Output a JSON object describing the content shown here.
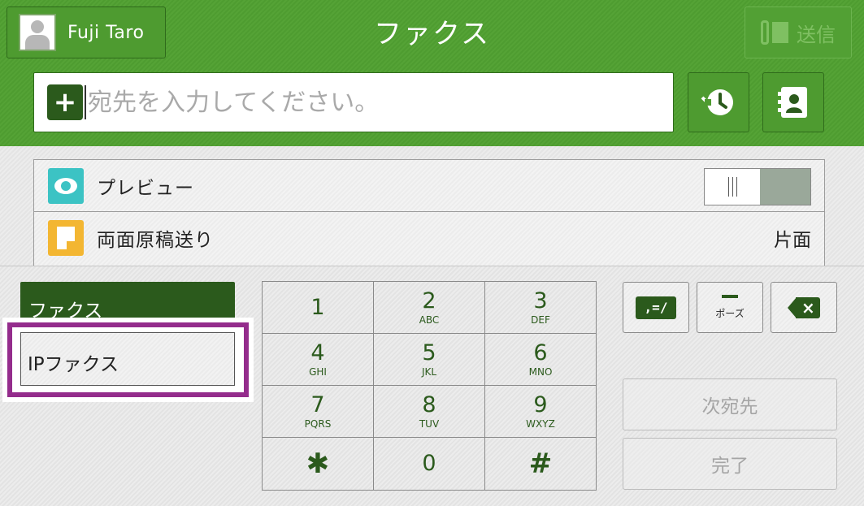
{
  "header": {
    "user_name": "Fuji  Taro",
    "title": "ファクス",
    "send_label": "送信"
  },
  "destination": {
    "placeholder": "宛先を入力してください。"
  },
  "features": {
    "preview_label": "プレビュー",
    "duplex_label": "両面原稿送り",
    "duplex_value": "片面"
  },
  "modes": {
    "fax_label": "ファクス",
    "ipfax_label": "IPファクス"
  },
  "keypad": {
    "keys": [
      {
        "num": "1",
        "sub": ""
      },
      {
        "num": "2",
        "sub": "ABC"
      },
      {
        "num": "3",
        "sub": "DEF"
      },
      {
        "num": "4",
        "sub": "GHI"
      },
      {
        "num": "5",
        "sub": "JKL"
      },
      {
        "num": "6",
        "sub": "MNO"
      },
      {
        "num": "7",
        "sub": "PQRS"
      },
      {
        "num": "8",
        "sub": "TUV"
      },
      {
        "num": "9",
        "sub": "WXYZ"
      },
      {
        "num": "✱",
        "sub": ""
      },
      {
        "num": "0",
        "sub": ""
      },
      {
        "num": "#",
        "sub": ""
      }
    ]
  },
  "tools": {
    "sequence_symbol": ",=/",
    "pause_label": "ポーズ",
    "next_destination_label": "次宛先",
    "done_label": "完了"
  },
  "icons": [
    "avatar-icon",
    "send-icon",
    "plus-icon",
    "history-icon",
    "address-book-icon",
    "eye-icon",
    "document-icon",
    "backspace-icon"
  ],
  "colors": {
    "header_green": "#55a336",
    "dark_green": "#2b5a1c",
    "highlight_purple": "#942c8c",
    "preview_teal": "#3cc3c4",
    "duplex_orange": "#f3b632"
  }
}
